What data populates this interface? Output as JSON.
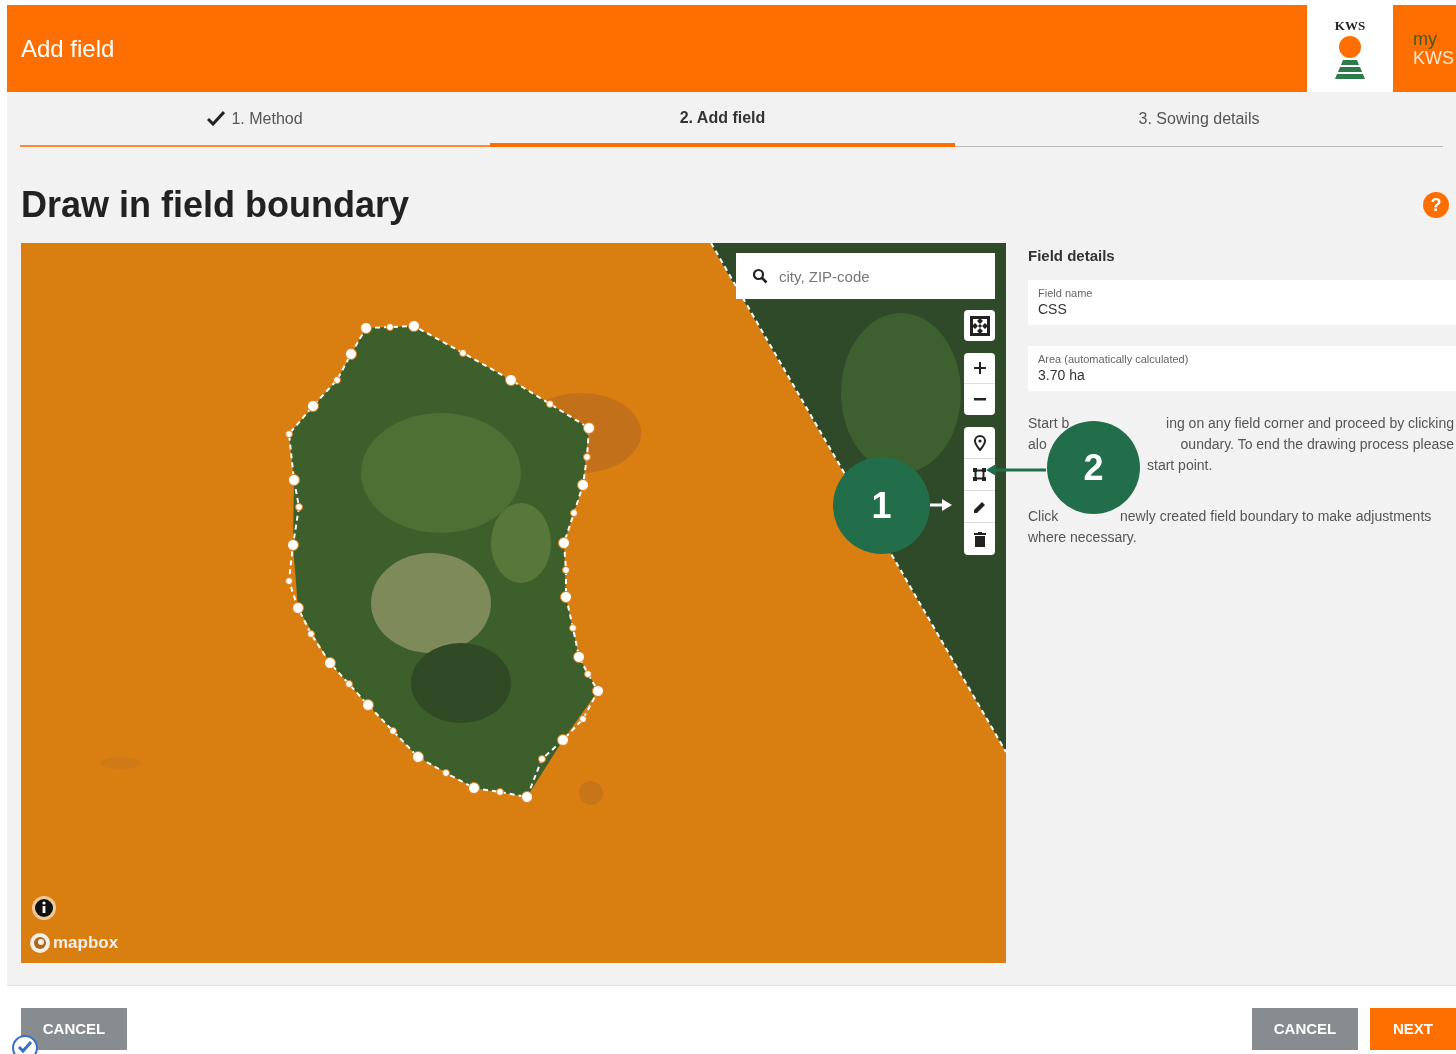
{
  "header": {
    "title": "Add field",
    "logo_wordmark": "KWS",
    "my_kws": {
      "line_1": "my",
      "line_2": "KWS"
    }
  },
  "steps": [
    {
      "label": "1. Method",
      "completed": true,
      "selected": false
    },
    {
      "label": "2. Add field",
      "completed": false,
      "selected": true
    },
    {
      "label": "3. Sowing details",
      "completed": false,
      "selected": false
    }
  ],
  "page_title": "Draw in field boundary",
  "help_button": {
    "label": "?"
  },
  "map": {
    "search": {
      "placeholder": "city, ZIP-code"
    },
    "attribution": "mapbox"
  },
  "callouts": [
    {
      "label": "1"
    },
    {
      "label": "2"
    }
  ],
  "field_details": {
    "title": "Field details",
    "fields": [
      {
        "label": "Field name",
        "value": "CSS"
      },
      {
        "label": "Area (automatically calculated)",
        "value": "3.70 ha"
      }
    ],
    "instructions": [
      {
        "lines": [
          [
            "Start b",
            "ing on any field corner and proceed by clicking"
          ],
          [
            "alo",
            "oundary. To end the drawing process please"
          ],
          [
            "start point."
          ]
        ]
      },
      {
        "lines": [
          [
            "Click",
            "newly created field boundary to make adjustments"
          ],
          [
            "where necessary."
          ]
        ]
      }
    ]
  },
  "footer": {
    "left_buttons": [
      {
        "label": "CANCEL",
        "kind": "secondary"
      }
    ],
    "right_buttons": [
      {
        "label": "CANCEL",
        "kind": "secondary"
      },
      {
        "label": "NEXT",
        "kind": "primary"
      }
    ]
  }
}
